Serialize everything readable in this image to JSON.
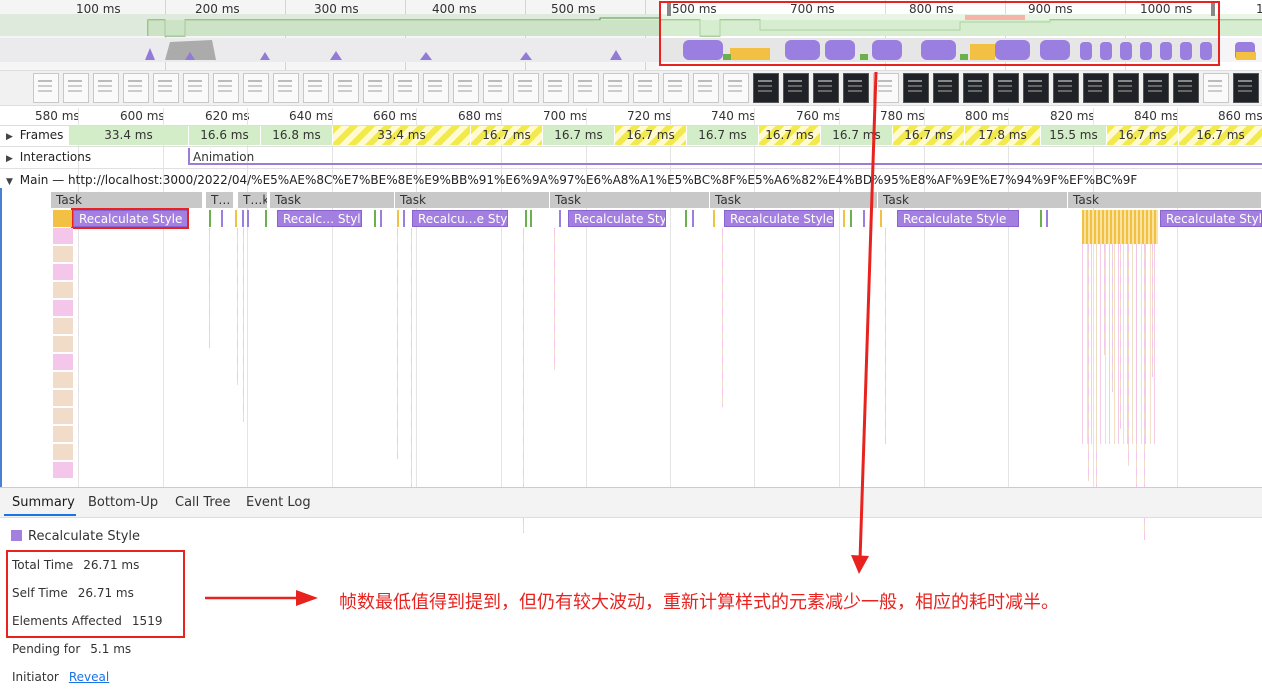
{
  "overview": {
    "ticks": [
      "100 ms",
      "200 ms",
      "300 ms",
      "400 ms",
      "500 ms",
      "700 ms",
      "800 ms",
      "900 ms",
      "1000 ms",
      "1"
    ],
    "selection_start": "500 ms"
  },
  "ruler": {
    "ticks": [
      "580 ms",
      "600 ms",
      "620 ms",
      "640 ms",
      "660 ms",
      "680 ms",
      "700 ms",
      "720 ms",
      "740 ms",
      "760 ms",
      "780 ms",
      "800 ms",
      "820 ms",
      "840 ms",
      "860 ms"
    ]
  },
  "tracks": {
    "frames_label": "Frames",
    "frames": [
      "33.4 ms",
      "16.6 ms",
      "16.8 ms",
      "33.4 ms",
      "16.7 ms",
      "16.7 ms",
      "16.7 ms",
      "16.7 ms",
      "16.7 ms",
      "16.7 ms",
      "16.7 ms",
      "17.8 ms",
      "15.5 ms",
      "16.7 ms",
      "16.7 ms"
    ],
    "interactions_label": "Interactions",
    "animation_label": "Animation",
    "main_label": "Main — http://localhost:3000/2022/04/%E5%AE%8C%E7%BE%8E%E9%BB%91%E6%9A%97%E6%A8%A1%E5%BC%8F%E5%A6%82%E4%BD%95%E8%AF%9E%E7%94%9F%EF%BC%9F"
  },
  "flame": {
    "tasks": [
      "Task",
      "T…",
      "T…k",
      "Task",
      "Task",
      "Task",
      "Task",
      "Task",
      "Task"
    ],
    "events": [
      "Recalculate Style",
      "Recalc… Style",
      "Recalcu…e Style",
      "Recalculate Style",
      "Recalculate Style",
      "Recalculate Style",
      "Recalculate Style"
    ]
  },
  "tabs": [
    "Summary",
    "Bottom-Up",
    "Call Tree",
    "Event Log"
  ],
  "summary": {
    "title": "Recalculate Style",
    "title_color": "#a37fe0",
    "total_time_label": "Total Time",
    "total_time": "26.71 ms",
    "self_time_label": "Self Time",
    "self_time": "26.71 ms",
    "elements_label": "Elements Affected",
    "elements": "1519",
    "pending_label": "Pending for",
    "pending": "5.1 ms",
    "initiator_label": "Initiator",
    "initiator_link": "Reveal"
  },
  "annotation": {
    "text": "帧数最低值得到提到，但仍有较大波动，重新计算样式的元素减少一般，相应的耗时减半。",
    "color": "#e8231f"
  }
}
